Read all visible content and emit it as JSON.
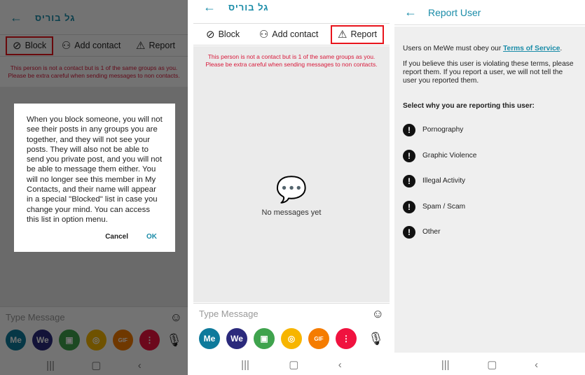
{
  "chat": {
    "contact_name": "גל בוריס",
    "toolbar": {
      "block": "Block",
      "add_contact": "Add contact",
      "report": "Report"
    },
    "warning": "This person is not a contact but is 1 of the same groups as you. Please be extra careful when sending messages to non contacts.",
    "empty_state": "No messages yet",
    "input_placeholder": "Type Message",
    "buttons": [
      {
        "label": "Me",
        "color": "#0e7a9b"
      },
      {
        "label": "We",
        "color": "#2b2a7c"
      },
      {
        "label": "image-icon",
        "color": "#3fa34d"
      },
      {
        "label": "camera-icon",
        "color": "#f7b500"
      },
      {
        "label": "GIF",
        "color": "#f57c00"
      },
      {
        "label": "more-icon",
        "color": "#f0123f"
      }
    ]
  },
  "dialog": {
    "text": "When you block someone, you will not see their posts in any groups you are together, and they will not see your posts. They will also not be able to send you private post, and you will not be able to message them either. You will no longer see this member in My Contacts, and their name will appear in a special \"Blocked\" list in case you change your mind. You can access this list in option menu.",
    "cancel": "Cancel",
    "ok": "OK"
  },
  "report": {
    "title": "Report User",
    "intro_prefix": "Users on MeWe must obey our ",
    "tos_link": "Terms of Service",
    "intro_suffix": ".",
    "explain": "If you believe this user is violating these terms, please report them. If you report a user, we will not tell the user you reported them.",
    "select": "Select why you are reporting this user:",
    "reasons": [
      "Pornography",
      "Graphic Violence",
      "Illegal Activity",
      "Spam / Scam",
      "Other"
    ]
  },
  "colors": {
    "accent": "#1a8ca8",
    "warning": "#d8193a",
    "highlight": "#e8141c"
  }
}
